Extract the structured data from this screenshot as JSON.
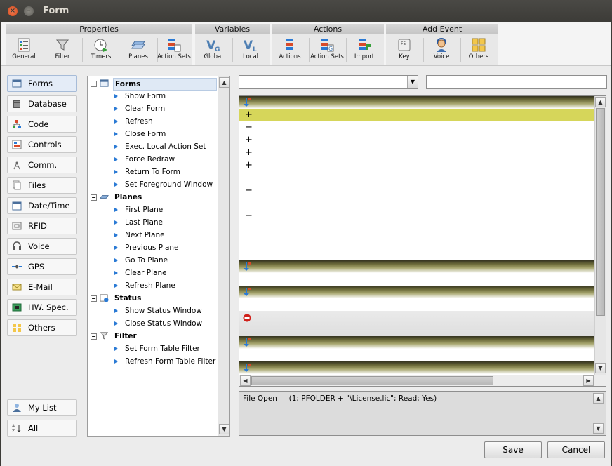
{
  "window": {
    "title": "Form"
  },
  "ribbon": {
    "groups": [
      {
        "title": "Properties",
        "buttons": [
          "General",
          "Filter",
          "Timers",
          "Planes",
          "Action Sets"
        ]
      },
      {
        "title": "Variables",
        "buttons": [
          "Global",
          "Local"
        ]
      },
      {
        "title": "Actions",
        "buttons": [
          "Actions",
          "Action Sets",
          "Import"
        ]
      },
      {
        "title": "Add Event",
        "buttons": [
          "Key",
          "Voice",
          "Others"
        ]
      }
    ]
  },
  "categories": [
    "Forms",
    "Database",
    "Code",
    "Controls",
    "Comm.",
    "Files",
    "Date/Time",
    "RFID",
    "Voice",
    "GPS",
    "E-Mail",
    "HW. Spec.",
    "Others"
  ],
  "bottom_categories": [
    "My List",
    "All"
  ],
  "tree": [
    {
      "label": "Forms",
      "children": [
        "Show Form",
        "Clear Form",
        "Refresh",
        "Close Form",
        "Exec. Local Action Set",
        "Force Redraw",
        "Return To Form",
        "Set Foreground Window"
      ]
    },
    {
      "label": "Planes",
      "children": [
        "First Plane",
        "Last Plane",
        "Next Plane",
        "Previous Plane",
        "Go To Plane",
        "Clear Plane",
        "Refresh Plane"
      ]
    },
    {
      "label": "Status",
      "children": [
        "Show Status Window",
        "Close Status Window"
      ]
    },
    {
      "label": "Filter",
      "children": [
        "Set Form Table Filter",
        "Refresh Form Table Filter"
      ]
    }
  ],
  "action_rows": [
    "+",
    "−",
    "+",
    "+",
    "+",
    "−",
    "−"
  ],
  "description": "File Open     (1; PFOLDER + \"\\License.lic\"; Read; Yes)",
  "buttons": {
    "save": "Save",
    "cancel": "Cancel"
  },
  "colors": {
    "selected_row": "#d6d65a",
    "band_dark": "#34331f",
    "accent": "#2a7ad5"
  }
}
